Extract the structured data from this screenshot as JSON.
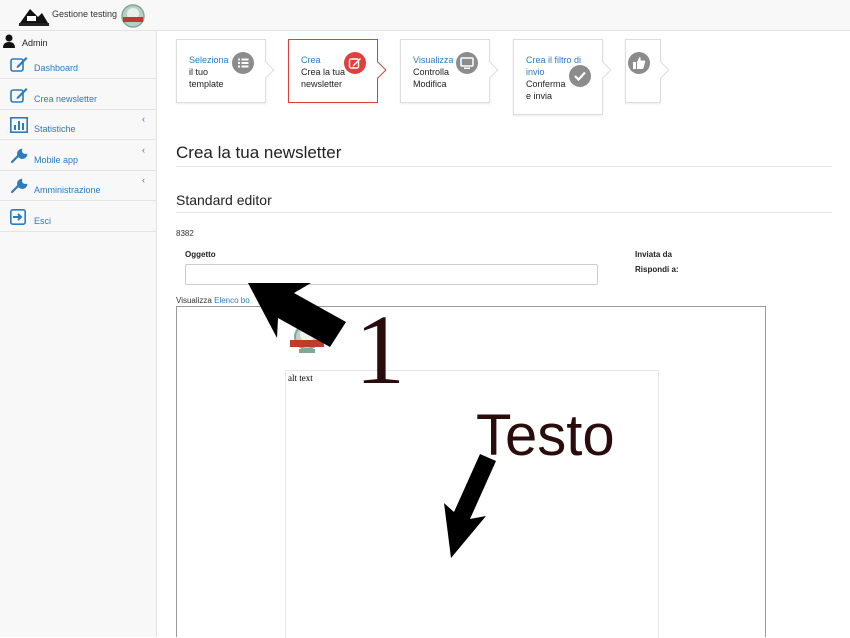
{
  "header": {
    "title": "Gestione testing"
  },
  "user": {
    "name": "Admin"
  },
  "sidebar": {
    "items": [
      {
        "label": "Dashboard",
        "icon": "edit-icon",
        "has_submenu": false
      },
      {
        "label": "Crea newsletter",
        "icon": "edit-icon",
        "has_submenu": false
      },
      {
        "label": "Statistiche",
        "icon": "bar-chart-icon",
        "has_submenu": true
      },
      {
        "label": "Mobile app",
        "icon": "wrench-icon",
        "has_submenu": true
      },
      {
        "label": "Amministrazione",
        "icon": "wrench-icon",
        "has_submenu": true
      },
      {
        "label": "Esci",
        "icon": "sign-out-icon",
        "has_submenu": false
      }
    ],
    "chevron": "‹"
  },
  "wizard": {
    "steps": [
      {
        "title": "Seleziona",
        "sub1": "il tuo",
        "sub2": "template",
        "icon": "list-icon",
        "active": false
      },
      {
        "title": "Crea",
        "sub1": "Crea la tua",
        "sub2": "newsletter",
        "icon": "edit-icon",
        "active": true
      },
      {
        "title": "Visualizza",
        "sub1": "Controlla",
        "sub2": "Modifica",
        "icon": "monitor-icon",
        "active": false
      },
      {
        "title1": "Crea il filtro di",
        "title2": "invio",
        "sub1": "Conferma",
        "sub2": "e invia",
        "icon": "check-icon",
        "active": false
      },
      {
        "icon": "thumbs-up-icon",
        "active": false
      }
    ]
  },
  "main": {
    "page_title": "Crea la tua newsletter",
    "section_title": "Standard editor",
    "id_text": "8382",
    "subject_label": "Oggetto",
    "subject_value": "",
    "sent_from_label": "Inviata da",
    "reply_to_label": "Rispondi a:",
    "view_prefix": "Visualizza",
    "view_link": "Elenco bo",
    "alt_text": "alt text"
  },
  "annotations": {
    "number": "1",
    "text": "Testo"
  },
  "colors": {
    "link": "#2a7bbf",
    "active_step": "#e0403c",
    "icon_grey": "#8c8c8c",
    "annotation": "#2a0c0c"
  }
}
